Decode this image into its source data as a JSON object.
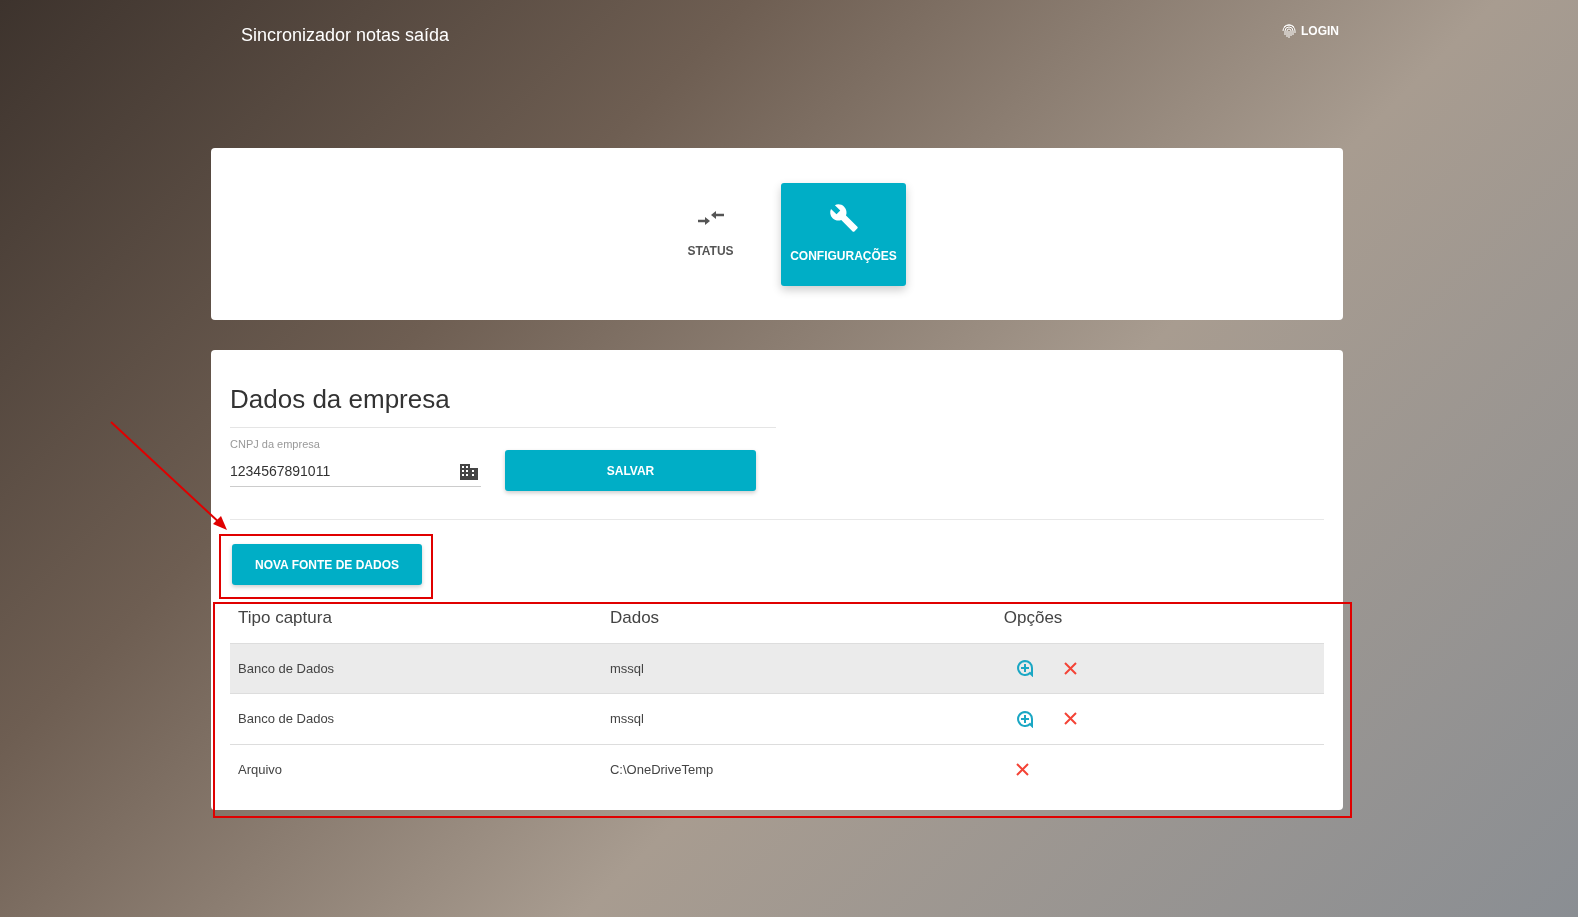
{
  "app_title": "Sincronizador notas saída",
  "login": {
    "label": "LOGIN"
  },
  "tabs": [
    {
      "label": "STATUS",
      "kind": "arrows",
      "selected": false
    },
    {
      "label": "CONFIGURAÇÕES",
      "kind": "wrench",
      "selected": true
    }
  ],
  "company": {
    "heading": "Dados da empresa",
    "field_label": "CNPJ da empresa",
    "field_value": "1234567891011",
    "save_button": "SALVAR"
  },
  "new_source_button": "NOVA FONTE DE DADOS",
  "table": {
    "columns": [
      "Tipo captura",
      "Dados",
      "Opções"
    ],
    "rows": [
      {
        "type": "Banco de Dados",
        "data": "mssql",
        "selected": true,
        "actions": [
          {
            "kind": "add"
          },
          {
            "kind": "delete"
          }
        ]
      },
      {
        "type": "Banco de Dados",
        "data": "mssql",
        "selected": false,
        "actions": [
          {
            "kind": "add"
          },
          {
            "kind": "delete"
          }
        ]
      },
      {
        "type": "Arquivo",
        "data": "C:\\OneDriveTemp",
        "selected": false,
        "actions": [
          {
            "kind": "delete"
          }
        ]
      }
    ]
  }
}
